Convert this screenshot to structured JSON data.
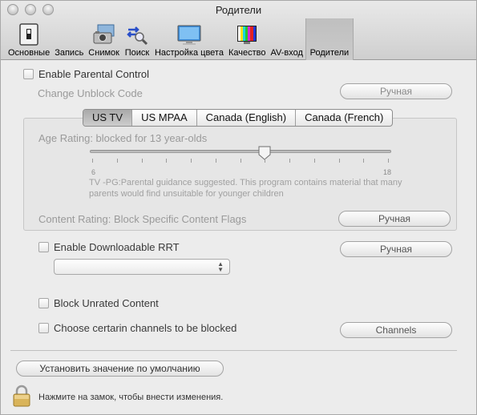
{
  "window": {
    "title": "Родители"
  },
  "toolbar": {
    "items": [
      {
        "label": "Основные",
        "icon": "switch-icon"
      },
      {
        "label": "Запись",
        "icon": "record-icon"
      },
      {
        "label": "Снимок",
        "icon": "camera-icon"
      },
      {
        "label": "Поиск",
        "icon": "search-arrows-icon"
      },
      {
        "label": "Настройка цвета",
        "icon": "monitor-icon"
      },
      {
        "label": "Качество",
        "icon": "color-bars-icon"
      },
      {
        "label": "AV-вход",
        "icon": "av-input-icon"
      },
      {
        "label": "Родители",
        "icon": "parents-icon",
        "selected": true
      }
    ]
  },
  "parental": {
    "enable_label": "Enable Parental Control",
    "enabled": false,
    "change_code_label": "Change Unblock Code",
    "change_code_button": "Ручная"
  },
  "tabs": {
    "items": [
      "US TV",
      "US MPAA",
      "Canada (English)",
      "Canada (French)"
    ],
    "selected": "US TV"
  },
  "rating": {
    "age_label": "Age Rating: blocked for 13 year-olds",
    "slider_min": "6",
    "slider_max": "18",
    "slider_value": 13,
    "description": "TV -PG:Parental guidance suggested. This program contains material that many parents would find unsuitable for younger children",
    "content_label": "Content Rating: Block Specific Content Flags",
    "content_button": "Ручная"
  },
  "rrt": {
    "enable_label": "Enable Downloadable RRT",
    "enabled": false,
    "button": "Ручная",
    "select_value": ""
  },
  "unrated": {
    "label": "Block Unrated Content",
    "checked": false
  },
  "channels": {
    "label": "Choose certarin channels to be blocked",
    "checked": false,
    "button": "Channels"
  },
  "footer": {
    "default_button": "Установить значение по умолчанию",
    "lock_text": "Нажмите на замок, чтобы внести изменения."
  },
  "colors": {
    "window_bg": "#ececec",
    "selected_tab": "#bdbdbd",
    "disabled_text": "#9a9a9a"
  }
}
